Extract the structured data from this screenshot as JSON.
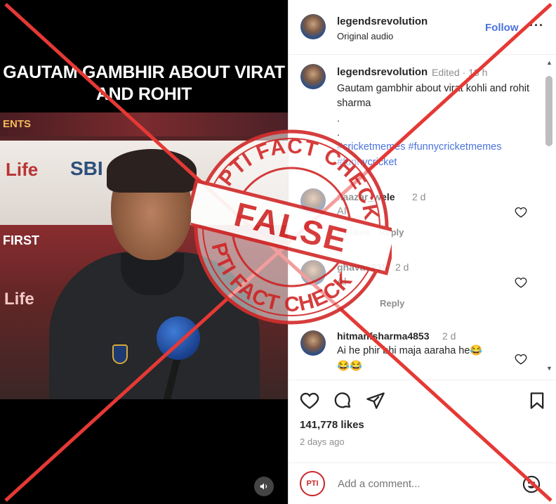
{
  "video": {
    "title": "GAUTAM GAMBHIR ABOUT VIRAT AND ROHIT",
    "sponsors": [
      "Life",
      "SBI",
      "Life",
      "FIRST",
      "Life",
      "ENTS"
    ]
  },
  "header": {
    "username": "legendsrevolution",
    "subtitle": "Original audio",
    "follow_label": "Follow",
    "more_label": "···"
  },
  "caption": {
    "username": "legendsrevolution",
    "meta": "Edited · 18 h",
    "text": "Gautam gambhir about virat kohli and rohit sharma",
    "dot1": ".",
    "dot2": ".",
    "tags": "#cricketmemes #funnycricketmemes #funnycricket"
  },
  "comments": [
    {
      "username": "naazar_wele",
      "time": "2 d",
      "text": "AI",
      "likes": "21 likes",
      "reply": "Reply"
    },
    {
      "username": "ghavas235",
      "time": "2 d",
      "text": "AI",
      "likes": "",
      "reply": "Reply"
    },
    {
      "username": "hitmanfsharma4853",
      "time": "2 d",
      "text": "Ai he phir bhi maja aaraha he😂",
      "text2": "😂😂"
    }
  ],
  "actions": {
    "likes": "141,778 likes",
    "ago": "2 days ago",
    "add_comment_placeholder": "Add a comment...",
    "pti_logo": "PTI"
  },
  "stamp": {
    "top_text": "PTI FACT CHECK",
    "bottom_text": "PTI FACT CHECK",
    "verdict": "FALSE"
  },
  "icons": {
    "heart": "heart-icon",
    "comment": "comment-icon",
    "share": "share-icon",
    "save": "bookmark-icon",
    "sound": "speaker-icon",
    "emoji": "emoji-icon"
  },
  "colors": {
    "accent_blue": "#4a73dc",
    "stamp_red": "#d32f2f",
    "cross_red": "#e53935"
  }
}
